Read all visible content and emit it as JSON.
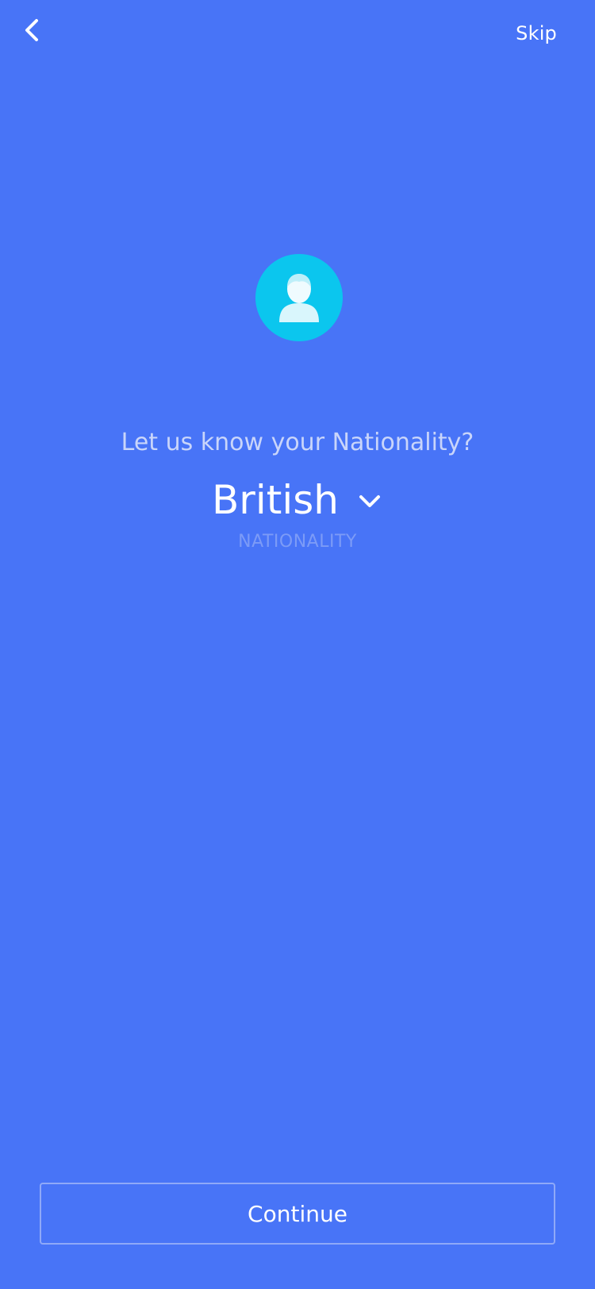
{
  "header": {
    "back_icon": "chevron-left-icon",
    "skip_label": "Skip"
  },
  "avatar": {
    "icon": "user-icon",
    "color": "#0BC6EE"
  },
  "main": {
    "question": "Let us know your Nationality?",
    "nationality_value": "British",
    "dropdown_icon": "chevron-down-icon",
    "field_label": "NATIONALITY"
  },
  "footer": {
    "continue_label": "Continue"
  },
  "colors": {
    "background": "#4874F7",
    "text": "#FFFFFF",
    "muted_text": "#C9D5FA",
    "label_text": "#7C9BF7",
    "button_border": "#8FA9F8"
  }
}
